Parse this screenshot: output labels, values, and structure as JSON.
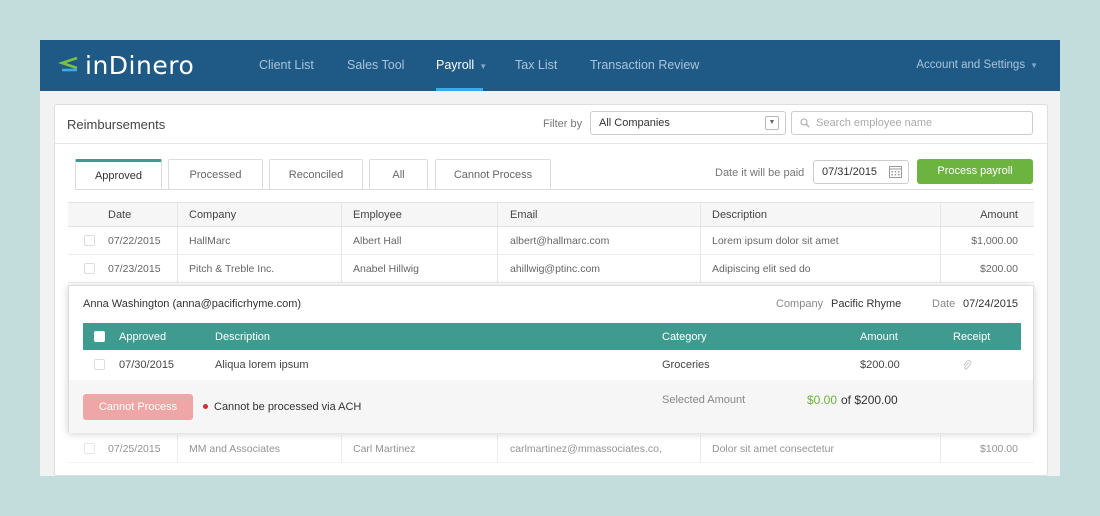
{
  "nav": {
    "logo": "inDinero",
    "items": [
      {
        "label": "Client List"
      },
      {
        "label": "Sales Tool"
      },
      {
        "label": "Payroll"
      },
      {
        "label": "Tax List"
      },
      {
        "label": "Transaction Review"
      }
    ],
    "account": "Account and Settings"
  },
  "panel": {
    "title": "Reimbursements",
    "filter_label": "Filter by",
    "filter_value": "All Companies",
    "search_placeholder": "Search employee name"
  },
  "tabs": [
    {
      "label": "Approved",
      "active": true
    },
    {
      "label": "Processed"
    },
    {
      "label": "Reconciled"
    },
    {
      "label": "All"
    },
    {
      "label": "Cannot Process"
    }
  ],
  "payment": {
    "date_label": "Date it will be paid",
    "date_value": "07/31/2015",
    "button": "Process payroll"
  },
  "table": {
    "headers": [
      "Date",
      "Company",
      "Employee",
      "Email",
      "Description",
      "Amount"
    ],
    "rows": [
      {
        "date": "07/22/2015",
        "company": "HallMarc",
        "employee": "Albert Hall",
        "email": "albert@hallmarc.com",
        "description": "Lorem ipsum dolor sit amet",
        "amount": "$1,000.00"
      },
      {
        "date": "07/23/2015",
        "company": "Pitch & Treble Inc.",
        "employee": "Anabel Hillwig",
        "email": "ahillwig@ptinc.com",
        "description": "Adipiscing elit sed do",
        "amount": "$200.00"
      },
      {
        "date": "07/25/2015",
        "company": "MM and Associates",
        "employee": "Carl Martinez",
        "email": "carlmartinez@mmassociates.co,",
        "description": "Dolor sit amet consectetur",
        "amount": "$100.00"
      }
    ]
  },
  "expanded": {
    "employee": "Anna Washington (anna@pacificrhyme.com)",
    "company_label": "Company",
    "company": "Pacific Rhyme",
    "date_label": "Date",
    "date": "07/24/2015",
    "sub_headers": [
      "Approved",
      "Description",
      "Category",
      "Amount",
      "Receipt"
    ],
    "item": {
      "date": "07/30/2015",
      "description": "Aliqua lorem ipsum",
      "category": "Groceries",
      "amount": "$200.00"
    },
    "cannot_button": "Cannot Process",
    "error": "Cannot be processed via ACH",
    "selected_label": "Selected Amount",
    "selected_amount": "$0.00",
    "selected_of": "of $200.00"
  },
  "colors": {
    "nav_bg": "#1f5a86",
    "accent_teal": "#3f9b8f",
    "green": "#6db33f",
    "error_red": "#d12f2f",
    "disabled_pink": "#eea7a6",
    "page_bg": "#c3dcdc"
  },
  "icons": [
    "logo-arrows-icon",
    "chevron-down-icon",
    "search-icon",
    "calendar-icon",
    "paperclip-icon",
    "error-dot-icon"
  ]
}
